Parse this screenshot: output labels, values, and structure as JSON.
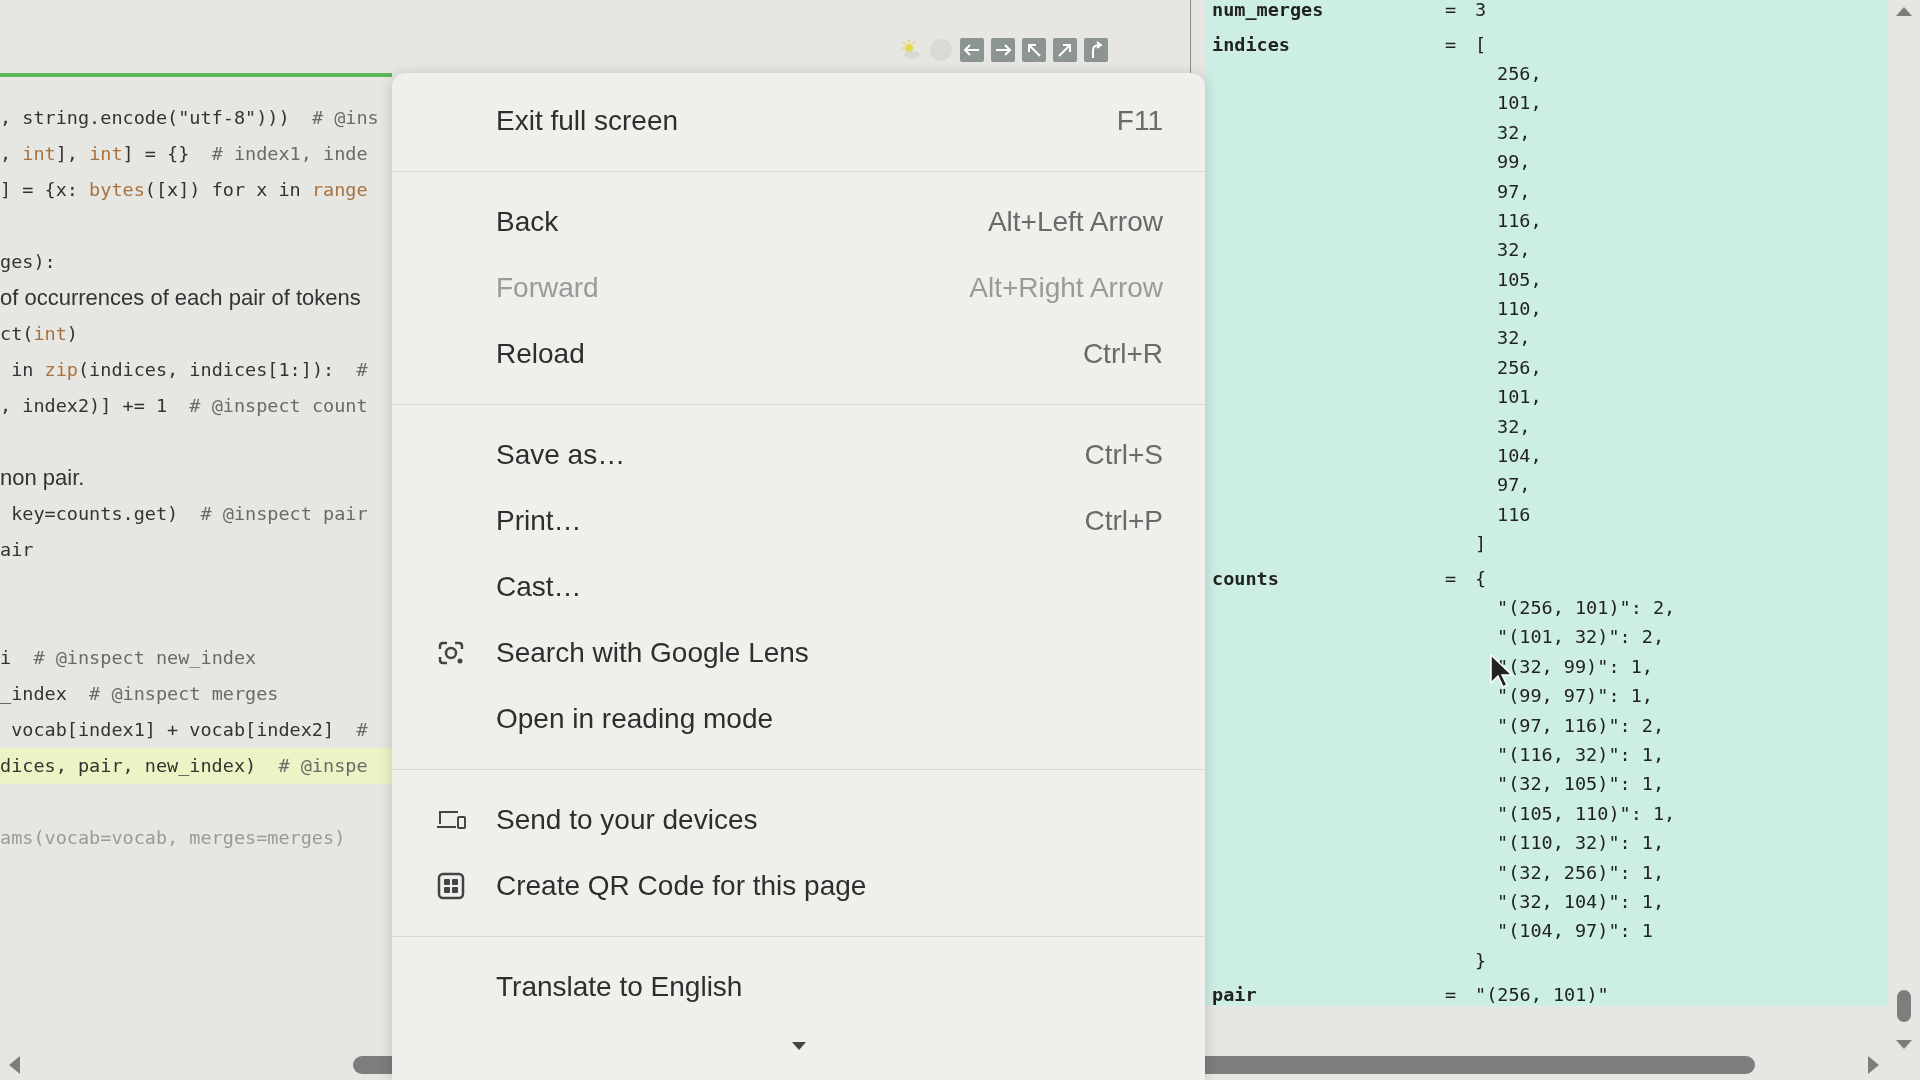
{
  "code": {
    "lines": [
      {
        "kind": "code",
        "highlighted": false,
        "dimmed": false,
        "tokens": [
          {
            "kind": "plain",
            "text": ", string.encode(\"utf-8\")))  "
          },
          {
            "kind": "comment",
            "text": "# @ins"
          }
        ]
      },
      {
        "kind": "code",
        "highlighted": false,
        "dimmed": false,
        "tokens": [
          {
            "kind": "plain",
            "text": ", "
          },
          {
            "kind": "builtin",
            "text": "int"
          },
          {
            "kind": "plain",
            "text": "], "
          },
          {
            "kind": "builtin",
            "text": "int"
          },
          {
            "kind": "plain",
            "text": "] = {}  "
          },
          {
            "kind": "comment",
            "text": "# index1, inde"
          }
        ]
      },
      {
        "kind": "code",
        "highlighted": false,
        "dimmed": false,
        "tokens": [
          {
            "kind": "plain",
            "text": "] = {x: "
          },
          {
            "kind": "builtin",
            "text": "bytes"
          },
          {
            "kind": "plain",
            "text": "([x]) for x in "
          },
          {
            "kind": "builtin",
            "text": "range"
          }
        ]
      },
      {
        "kind": "blank"
      },
      {
        "kind": "code",
        "highlighted": false,
        "dimmed": false,
        "tokens": [
          {
            "kind": "plain",
            "text": "ges):"
          }
        ]
      },
      {
        "kind": "prose",
        "highlighted": false,
        "dimmed": false,
        "tokens": [
          {
            "kind": "plain",
            "text": "of occurrences of each pair of tokens"
          }
        ]
      },
      {
        "kind": "code",
        "highlighted": false,
        "dimmed": false,
        "tokens": [
          {
            "kind": "plain",
            "text": "ct("
          },
          {
            "kind": "builtin",
            "text": "int"
          },
          {
            "kind": "plain",
            "text": ")"
          }
        ]
      },
      {
        "kind": "code",
        "highlighted": false,
        "dimmed": false,
        "tokens": [
          {
            "kind": "plain",
            "text": " in "
          },
          {
            "kind": "builtin",
            "text": "zip"
          },
          {
            "kind": "plain",
            "text": "(indices, indices[1:]):  "
          },
          {
            "kind": "comment",
            "text": "#"
          }
        ]
      },
      {
        "kind": "code",
        "highlighted": false,
        "dimmed": false,
        "tokens": [
          {
            "kind": "plain",
            "text": ", index2)] += 1  "
          },
          {
            "kind": "comment",
            "text": "# @inspect count"
          }
        ]
      },
      {
        "kind": "blank"
      },
      {
        "kind": "prose",
        "highlighted": false,
        "dimmed": false,
        "tokens": [
          {
            "kind": "plain",
            "text": "non pair."
          }
        ]
      },
      {
        "kind": "code",
        "highlighted": false,
        "dimmed": false,
        "tokens": [
          {
            "kind": "plain",
            "text": " key=counts.get)  "
          },
          {
            "kind": "comment",
            "text": "# @inspect pair"
          }
        ]
      },
      {
        "kind": "code",
        "highlighted": false,
        "dimmed": false,
        "tokens": [
          {
            "kind": "plain",
            "text": "air"
          }
        ]
      },
      {
        "kind": "blank"
      },
      {
        "kind": "blank"
      },
      {
        "kind": "code",
        "highlighted": false,
        "dimmed": false,
        "tokens": [
          {
            "kind": "plain",
            "text": "i  "
          },
          {
            "kind": "comment",
            "text": "# @inspect new_index"
          }
        ]
      },
      {
        "kind": "code",
        "highlighted": false,
        "dimmed": false,
        "tokens": [
          {
            "kind": "plain",
            "text": "_index  "
          },
          {
            "kind": "comment",
            "text": "# @inspect merges"
          }
        ]
      },
      {
        "kind": "code",
        "highlighted": false,
        "dimmed": false,
        "tokens": [
          {
            "kind": "plain",
            "text": " vocab[index1] + vocab[index2]  "
          },
          {
            "kind": "comment",
            "text": "#"
          }
        ]
      },
      {
        "kind": "code",
        "highlighted": true,
        "dimmed": false,
        "tokens": [
          {
            "kind": "plain",
            "text": "dices, pair, new_index)  "
          },
          {
            "kind": "comment",
            "text": "# @inspe"
          }
        ]
      },
      {
        "kind": "blank"
      },
      {
        "kind": "code",
        "highlighted": false,
        "dimmed": true,
        "tokens": [
          {
            "kind": "plain",
            "text": "ams(vocab=vocab, merges=merges)"
          }
        ]
      }
    ]
  },
  "variables": [
    {
      "name": "num_merges",
      "equals": "=",
      "value": "3"
    },
    {
      "name": "indices",
      "equals": "=",
      "value": "[",
      "items": [
        "256,",
        "101,",
        "32,",
        "99,",
        "97,",
        "116,",
        "32,",
        "105,",
        "110,",
        "32,",
        "256,",
        "101,",
        "32,",
        "104,",
        "97,",
        "116"
      ],
      "close": "]"
    },
    {
      "name": "counts",
      "equals": "=",
      "value": "{",
      "items": [
        "\"(256, 101)\": 2,",
        "\"(101, 32)\": 2,",
        "\"(32, 99)\": 1,",
        "\"(99, 97)\": 1,",
        "\"(97, 116)\": 2,",
        "\"(116, 32)\": 1,",
        "\"(32, 105)\": 1,",
        "\"(105, 110)\": 1,",
        "\"(110, 32)\": 1,",
        "\"(32, 256)\": 1,",
        "\"(32, 104)\": 1,",
        "\"(104, 97)\": 1"
      ],
      "close": "}"
    },
    {
      "name": "pair",
      "equals": "=",
      "value": "\"(256, 101)\""
    }
  ],
  "menu": {
    "items": [
      {
        "kind": "item",
        "label": "Exit full screen",
        "shortcut": "F11",
        "disabled": false
      },
      {
        "kind": "separator"
      },
      {
        "kind": "item",
        "label": "Back",
        "shortcut": "Alt+Left Arrow",
        "disabled": false
      },
      {
        "kind": "item",
        "label": "Forward",
        "shortcut": "Alt+Right Arrow",
        "disabled": true
      },
      {
        "kind": "item",
        "label": "Reload",
        "shortcut": "Ctrl+R",
        "disabled": false
      },
      {
        "kind": "separator"
      },
      {
        "kind": "item",
        "label": "Save as…",
        "shortcut": "Ctrl+S",
        "disabled": false
      },
      {
        "kind": "item",
        "label": "Print…",
        "shortcut": "Ctrl+P",
        "disabled": false
      },
      {
        "kind": "item",
        "label": "Cast…",
        "disabled": false
      },
      {
        "kind": "lens",
        "label": "Search with Google Lens",
        "disabled": false
      },
      {
        "kind": "item",
        "label": "Open in reading mode",
        "disabled": false
      },
      {
        "kind": "separator"
      },
      {
        "kind": "devices",
        "label": "Send to your devices",
        "disabled": false
      },
      {
        "kind": "qrcode",
        "label": "Create QR Code for this page",
        "disabled": false
      },
      {
        "kind": "separator"
      },
      {
        "kind": "item",
        "label": "Translate to English",
        "disabled": false
      }
    ]
  }
}
